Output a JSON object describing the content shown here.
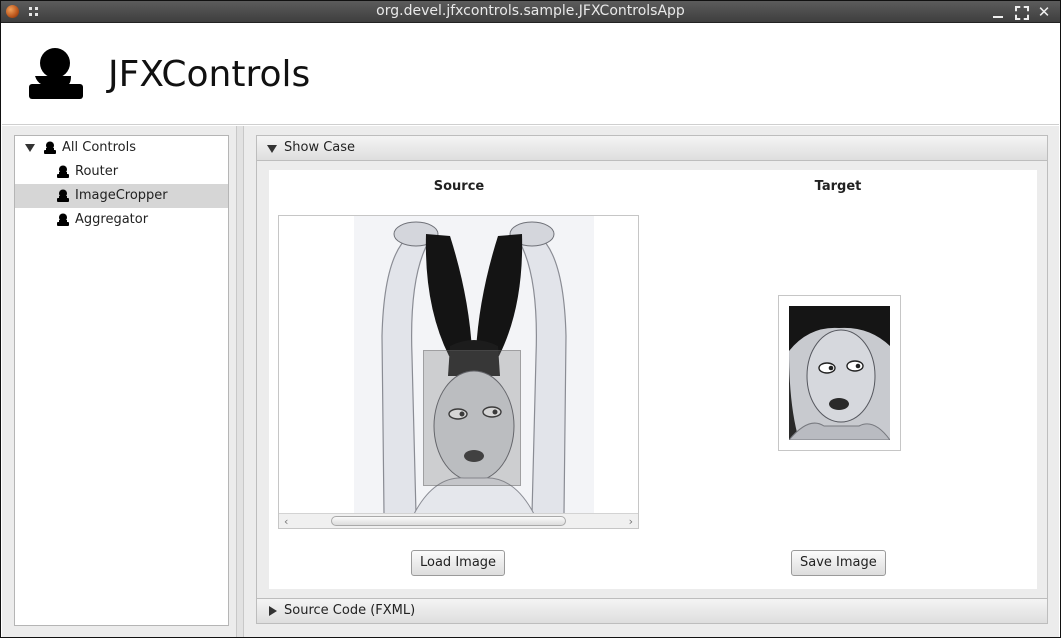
{
  "window": {
    "title": "org.devel.jfxcontrols.sample.JFXControlsApp",
    "controls": [
      "minimize-icon",
      "maximize-icon",
      "close-icon"
    ]
  },
  "header": {
    "app_title": "JFXControls",
    "logo_icon": "person-stamp-icon"
  },
  "sidebar": {
    "items": [
      {
        "label": "All Controls",
        "expanded": true,
        "selected": false,
        "icon": "person-stamp-icon"
      },
      {
        "label": "Router",
        "selected": false,
        "icon": "person-stamp-icon"
      },
      {
        "label": "ImageCropper",
        "selected": true,
        "icon": "person-stamp-icon"
      },
      {
        "label": "Aggregator",
        "selected": false,
        "icon": "person-stamp-icon"
      }
    ]
  },
  "panes": {
    "show_case": {
      "label": "Show Case",
      "expanded": true
    },
    "source_code": {
      "label": "Source Code (FXML)",
      "expanded": false
    }
  },
  "showcase": {
    "source_title": "Source",
    "target_title": "Target",
    "load_button": "Load Image",
    "save_button": "Save Image"
  },
  "colors": {
    "title_bar": "#4a4a4a",
    "selection": "#d6d6d6",
    "panel_bg": "#ececec"
  }
}
